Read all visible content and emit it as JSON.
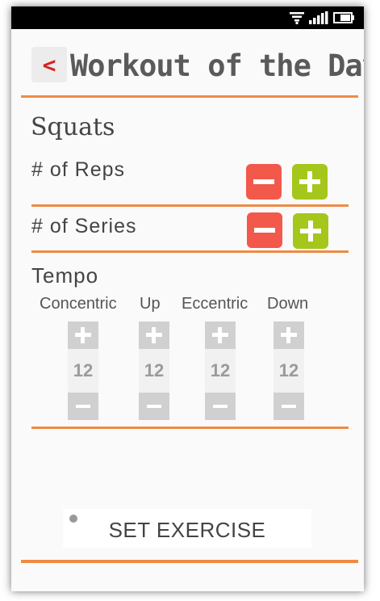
{
  "header": {
    "back_label": "<",
    "title": "Workout of the Day"
  },
  "exercise": {
    "name": "Squats"
  },
  "reps": {
    "label": "# of Reps"
  },
  "series": {
    "label": "# of Series"
  },
  "tempo": {
    "title": "Tempo",
    "columns": [
      {
        "label": "Concentric",
        "value": "12"
      },
      {
        "label": "Up",
        "value": "12"
      },
      {
        "label": "Eccentric",
        "value": "12"
      },
      {
        "label": "Down",
        "value": "12"
      }
    ]
  },
  "actions": {
    "set_exercise_label": "SET EXERCISE"
  },
  "colors": {
    "accent": "#ef8a45",
    "minus": "#f2594b",
    "plus": "#a5c61a",
    "back_arrow": "#d52222"
  },
  "status_icons": [
    "wifi-icon",
    "signal-icon",
    "battery-icon"
  ]
}
